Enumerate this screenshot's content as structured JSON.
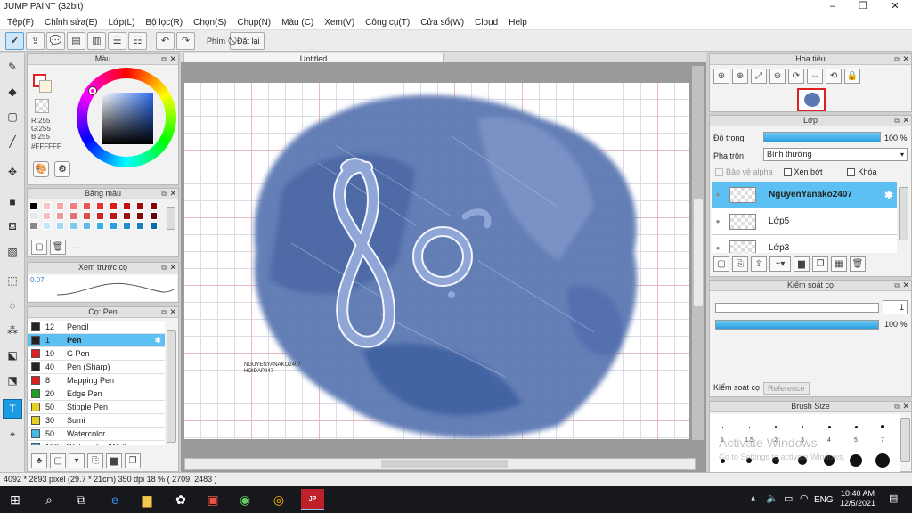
{
  "app": {
    "title": "JUMP PAINT (32bit)"
  },
  "menu": [
    "Tệp(F)",
    "Chỉnh sửa(E)",
    "Lớp(L)",
    "Bộ lọc(R)",
    "Chọn(S)",
    "Chụp(N)",
    "Màu (C)",
    "Xem(V)",
    "Công cụ(T)",
    "Cửa sổ(W)",
    "Cloud",
    "Help"
  ],
  "toolbar": {
    "phim": "Phím",
    "reset": "Đặt lại"
  },
  "canvas_tab": "Untitled",
  "color_panel": {
    "title": "Màu",
    "r": "R:255",
    "g": "G:255",
    "b": "B:255",
    "hex": "#FFFFFF"
  },
  "palette_panel": {
    "title": "Bảng màu",
    "label": "---"
  },
  "preview_panel": {
    "title": "Xem trước cọ",
    "size": "0.07"
  },
  "brush_panel": {
    "title": "Cọ: Pen",
    "rows": [
      {
        "size": "12",
        "name": "Pencil",
        "color": "#222222"
      },
      {
        "size": "1",
        "name": "Pen",
        "color": "#222222"
      },
      {
        "size": "10",
        "name": "G Pen",
        "color": "#e02020"
      },
      {
        "size": "40",
        "name": "Pen (Sharp)",
        "color": "#222222"
      },
      {
        "size": "8",
        "name": "Mapping Pen",
        "color": "#e02020"
      },
      {
        "size": "20",
        "name": "Edge Pen",
        "color": "#20a020"
      },
      {
        "size": "50",
        "name": "Stipple Pen",
        "color": "#e0d020"
      },
      {
        "size": "30",
        "name": "Sumi",
        "color": "#e0d020"
      },
      {
        "size": "50",
        "name": "Watercolor",
        "color": "#40b8e8"
      },
      {
        "size": "100",
        "name": "Watercolor (Wet)",
        "color": "#40b8e8"
      }
    ]
  },
  "navigator": {
    "title": "Hoa tiêu"
  },
  "layers": {
    "title": "Lớp",
    "opacity_label": "Độ trong",
    "opacity_value": "100 %",
    "opacity": 100,
    "blend_label": "Pha trộn",
    "blend_value": "Bình thường",
    "protect_alpha": "Bảo vệ alpha",
    "clipping": "Xén bớt",
    "lock": "Khóa",
    "rows": [
      {
        "name": "NguyenYanako2407"
      },
      {
        "name": "Lớp5"
      },
      {
        "name": "Lớp3"
      }
    ]
  },
  "brush_control": {
    "title": "Kiểm soát cọ",
    "size_value": "1",
    "opacity_value": "100 %",
    "opacity": 100,
    "tab1": "Kiểm soát cọ",
    "tab2": "Reference"
  },
  "brush_size": {
    "title": "Brush Size",
    "labels": [
      "1",
      "1.5",
      "2",
      "3",
      "4",
      "5",
      "7"
    ]
  },
  "artwork_signature": "NGUYENYANAKO2407\nHOIDAP247",
  "windows_watermark": {
    "line1": "Activate Windows",
    "line2": "Go to Settings to activate Windows."
  },
  "status": "4092 * 2893 pixel   (29.7 * 21cm)   350 dpi   18 %   ( 2709, 2483 )",
  "taskbar": {
    "lang": "ENG",
    "time": "10:40 AM",
    "date": "12/5/2021"
  },
  "colors": {
    "accent": "#1e9ae0",
    "layer_sel": "#5cc1f2",
    "art_blue": "#4a6aa8",
    "art_light": "#8fa6d6"
  }
}
